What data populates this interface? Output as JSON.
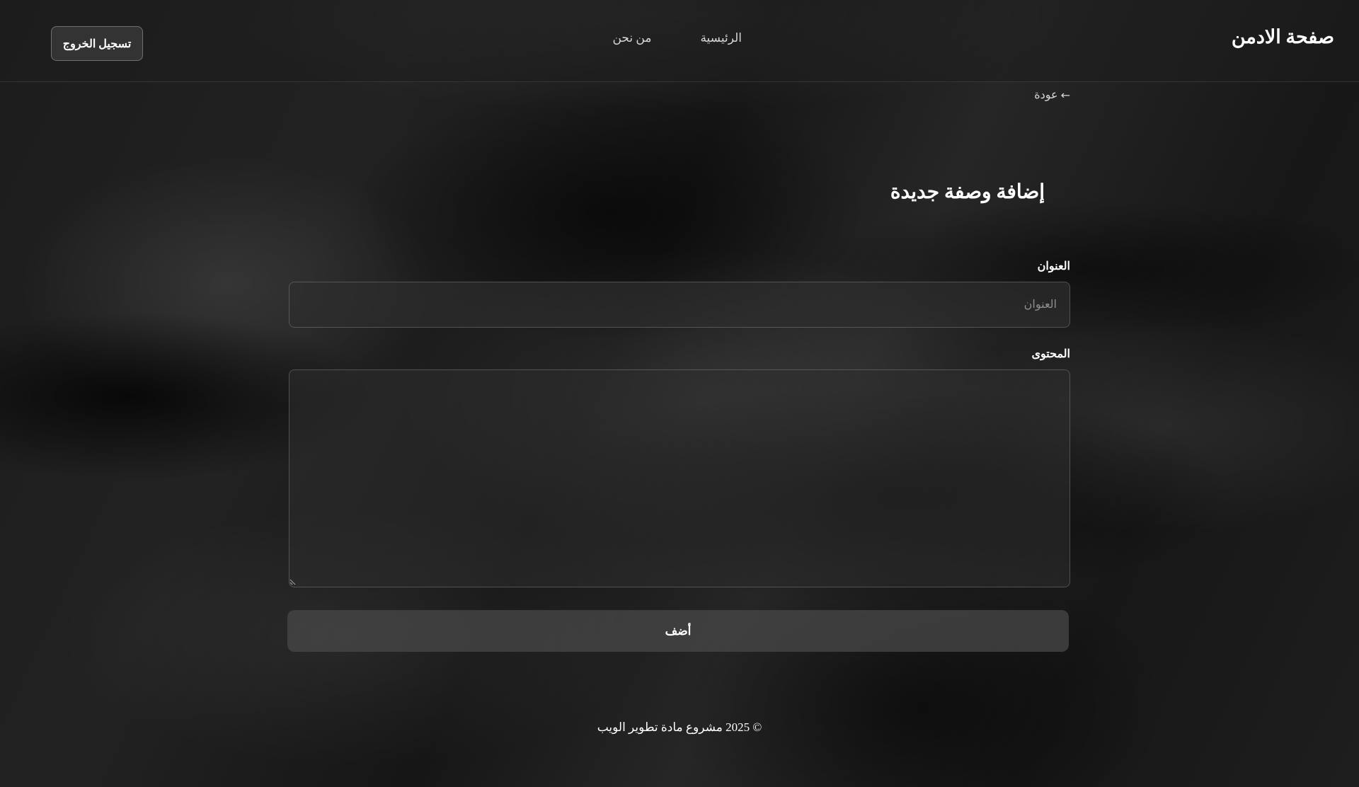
{
  "header": {
    "brand": "صفحة الادمن",
    "nav": [
      {
        "label": "الرئيسية"
      },
      {
        "label": "من نحن"
      }
    ],
    "logout_label": "تسجيل الخروج"
  },
  "back": {
    "arrow": "←",
    "label": "عودة"
  },
  "form": {
    "heading": "إضافة وصفة جديدة",
    "title_label": "العنوان",
    "title_placeholder": "العنوان",
    "title_value": "",
    "content_label": "المحتوى",
    "content_value": "",
    "submit_label": "أضف"
  },
  "footer": {
    "text": "© 2025 مشروع مادة تطوير الويب"
  },
  "colors": {
    "background": "#141414",
    "header_bg": "#1e1e1e",
    "input_bg": "#2d2d2d",
    "button_bg": "#484848",
    "text": "#ffffff",
    "muted_text": "#8e8e8e"
  }
}
